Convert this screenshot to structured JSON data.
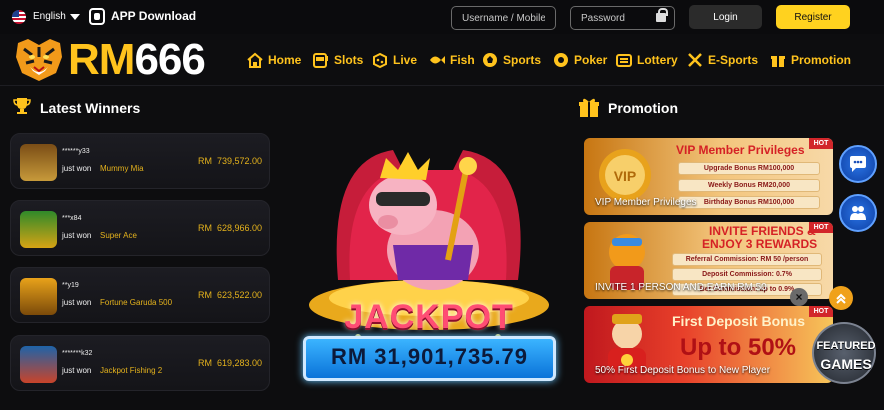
{
  "topbar": {
    "language": "English",
    "app_download": "APP Download",
    "username_placeholder": "Username / Mobile",
    "password_placeholder": "Password",
    "login": "Login",
    "register": "Register"
  },
  "brand": {
    "logo_rm": "RM",
    "logo_num": "666"
  },
  "nav": [
    {
      "label": "Home",
      "icon": "home-icon"
    },
    {
      "label": "Slots",
      "icon": "slot-machine-icon"
    },
    {
      "label": "Live",
      "icon": "live-casino-icon"
    },
    {
      "label": "Fish",
      "icon": "fish-icon"
    },
    {
      "label": "Sports",
      "icon": "soccer-ball-icon"
    },
    {
      "label": "Poker",
      "icon": "poker-chip-icon"
    },
    {
      "label": "Lottery",
      "icon": "lottery-icon"
    },
    {
      "label": "E-Sports",
      "icon": "crossed-swords-icon"
    },
    {
      "label": "Promotion",
      "icon": "gift-icon"
    }
  ],
  "winners": {
    "title": "Latest Winners",
    "items": [
      {
        "user": "******y33",
        "just_won": "just won",
        "game": "Mummy Mia",
        "currency": "RM",
        "amount": "739,572.00"
      },
      {
        "user": "***x84",
        "just_won": "just won",
        "game": "Super Ace",
        "currency": "RM",
        "amount": "628,966.00"
      },
      {
        "user": "**y19",
        "just_won": "just won",
        "game": "Fortune Garuda 500",
        "currency": "RM",
        "amount": "623,522.00"
      },
      {
        "user": "*******k32",
        "just_won": "just won",
        "game": "Jackpot Fishing 2",
        "currency": "RM",
        "amount": "619,283.00"
      }
    ]
  },
  "jackpot": {
    "label": "JACKPOT",
    "amount": "RM 31,901,735.79"
  },
  "promotion": {
    "title": "Promotion",
    "cards": [
      {
        "badge": "HOT",
        "heading": "VIP Member Privileges",
        "rows": [
          "Upgrade Bonus RM100,000",
          "Weekly Bonus RM20,000",
          "Birthday Bonus RM100,000"
        ],
        "caption": "VIP Member Privileges"
      },
      {
        "badge": "HOT",
        "heading_1": "INVITE FRIENDS &",
        "heading_2": "ENJOY 3 REWARDS",
        "rows": [
          "Referral Commission: RM 50 /person",
          "Deposit Commission: 0.7%",
          "Bet Commission: up to 0.9%"
        ],
        "caption": "INVITE 1 PERSON AND EARN RM 50"
      },
      {
        "badge": "HOT",
        "heading": "First Deposit Bonus",
        "big": "Up to 50%",
        "caption": "50% First Deposit Bonus to New Player"
      }
    ]
  },
  "floaters": {
    "featured_1": "FEATURED",
    "featured_2": "GAMES",
    "close": "×"
  }
}
